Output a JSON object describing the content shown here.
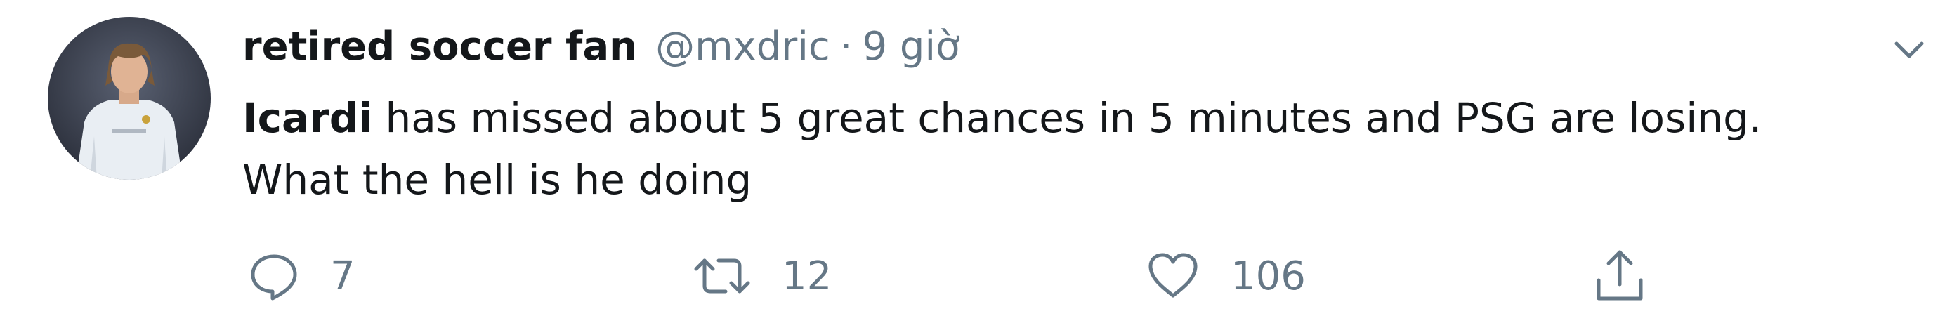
{
  "tweet": {
    "display_name": "retired soccer fan",
    "handle": "@mxdric",
    "separator": "·",
    "time": "9 giờ",
    "text_mention": "Icardi",
    "text_line1_rest": " has missed about 5 great chances in 5 minutes and PSG are losing.",
    "text_line2": "What the hell is he doing",
    "avatar_icon": "user-avatar-photo",
    "menu_icon": "chevron-down-icon",
    "accent_color": "#1da1f2",
    "secondary_text_color": "#657786"
  },
  "actions": {
    "reply": {
      "icon": "reply-icon",
      "count": "7"
    },
    "retweet": {
      "icon": "retweet-icon",
      "count": "12"
    },
    "like": {
      "icon": "heart-icon",
      "count": "106"
    },
    "share": {
      "icon": "share-icon"
    }
  }
}
